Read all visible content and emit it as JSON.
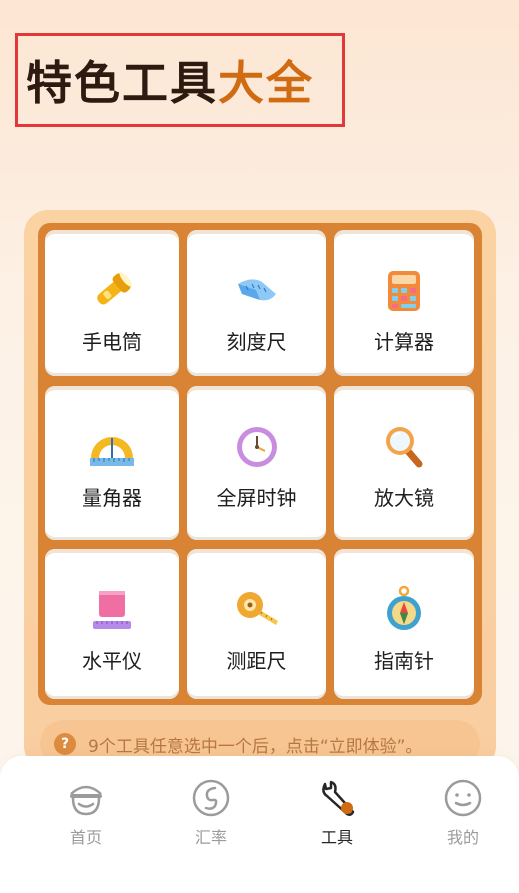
{
  "header": {
    "title_main": "特色工具",
    "title_accent": "大全"
  },
  "tools": [
    {
      "label": "手电筒",
      "icon": "flashlight-icon"
    },
    {
      "label": "刻度尺",
      "icon": "ruler-tape-icon"
    },
    {
      "label": "计算器",
      "icon": "calculator-icon"
    },
    {
      "label": "量角器",
      "icon": "protractor-icon"
    },
    {
      "label": "全屏时钟",
      "icon": "clock-icon"
    },
    {
      "label": "放大镜",
      "icon": "magnifier-icon"
    },
    {
      "label": "水平仪",
      "icon": "level-cube-icon"
    },
    {
      "label": "测距尺",
      "icon": "tape-measure-icon"
    },
    {
      "label": "指南针",
      "icon": "compass-icon"
    }
  ],
  "hint": {
    "icon_text": "?",
    "text": "9个工具任意选中一个后，点击“立即体验”。"
  },
  "tabbar": {
    "active": "工具",
    "items": [
      {
        "label": "首页",
        "icon": "home-face-icon"
      },
      {
        "label": "汇率",
        "icon": "exchange-rate-icon"
      },
      {
        "label": "工具",
        "icon": "wrench-icon"
      },
      {
        "label": "我的",
        "icon": "profile-smile-icon"
      }
    ]
  },
  "colors": {
    "accent": "#d06b12",
    "frame": "#d98434",
    "title_border": "#e2383a"
  }
}
